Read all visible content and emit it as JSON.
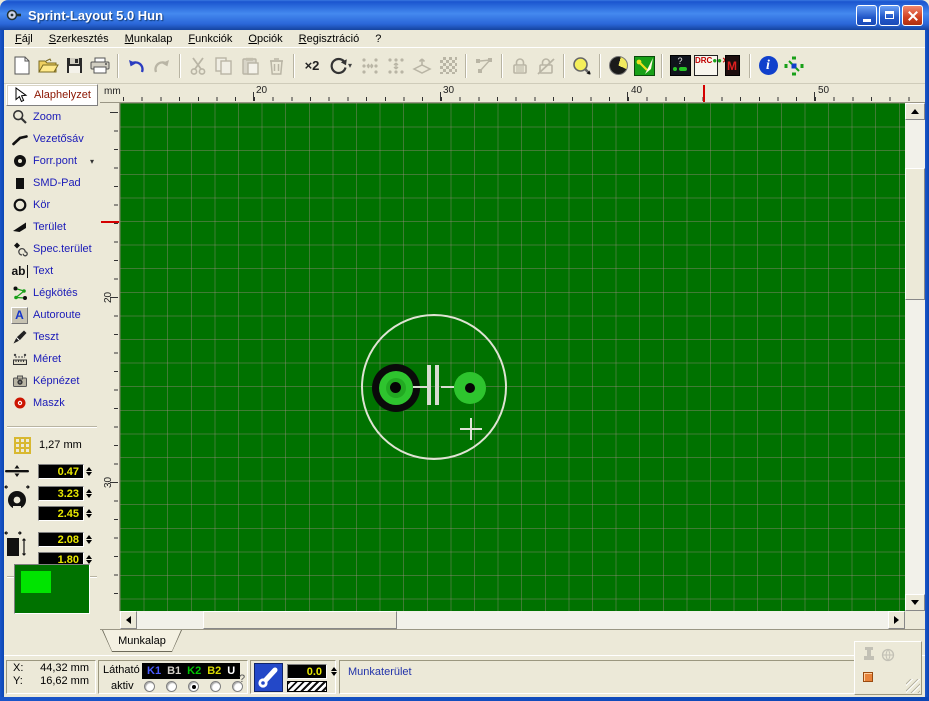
{
  "window": {
    "title": "Sprint-Layout 5.0 Hun"
  },
  "menu": {
    "items": [
      "Fájl",
      "Szerkesztés",
      "Munkalap",
      "Funkciók",
      "Opciók",
      "Regisztráció",
      "?"
    ]
  },
  "toolbar": {
    "duplicate_label": "×2",
    "drc_label": "DRC",
    "macro_label": "M",
    "help_label": "?",
    "info_label": "i"
  },
  "sidebar": {
    "tools": [
      "Alaphelyzet",
      "Zoom",
      "Vezetősáv",
      "Forr.pont",
      "SMD-Pad",
      "Kör",
      "Terület",
      "Spec.terület",
      "Text",
      "Légkötés",
      "Autoroute",
      "Teszt",
      "Méret",
      "Képnézet",
      "Maszk"
    ],
    "text_icon": "ab",
    "autoroute_icon": "A",
    "grid_value": "1,27 mm",
    "track_width": "0.47",
    "pad_diameter": "3.23",
    "pad_drill": "2.45",
    "smd_width": "2.08",
    "smd_height": "1.80"
  },
  "rulers": {
    "unit": "mm",
    "top_labels": [
      "20",
      "30",
      "40",
      "50"
    ],
    "left_labels": [
      "20",
      "30"
    ]
  },
  "canvas_colors": {
    "board_green": "#007200",
    "grid_line": "#8a7272",
    "pad_green": "#2ec42e",
    "silkscreen": "#dfe3d3",
    "viewport_green": "#00e400"
  },
  "tab": {
    "label": "Munkalap"
  },
  "statusbar": {
    "x_label": "X:",
    "x_value": "44,32 mm",
    "y_label": "Y:",
    "y_value": "16,62 mm",
    "visible_label": "Látható",
    "active_label": "aktiv",
    "help": "?",
    "layers": [
      {
        "label": "K1",
        "color": "#4a5cff"
      },
      {
        "label": "B1",
        "color": "#d4d0c8"
      },
      {
        "label": "K2",
        "color": "#00c400"
      },
      {
        "label": "B2",
        "color": "#d8d800"
      },
      {
        "label": "U",
        "color": "#ffffff"
      }
    ],
    "track_width_value": "0.0",
    "workspace_label": "Munkaterület"
  }
}
